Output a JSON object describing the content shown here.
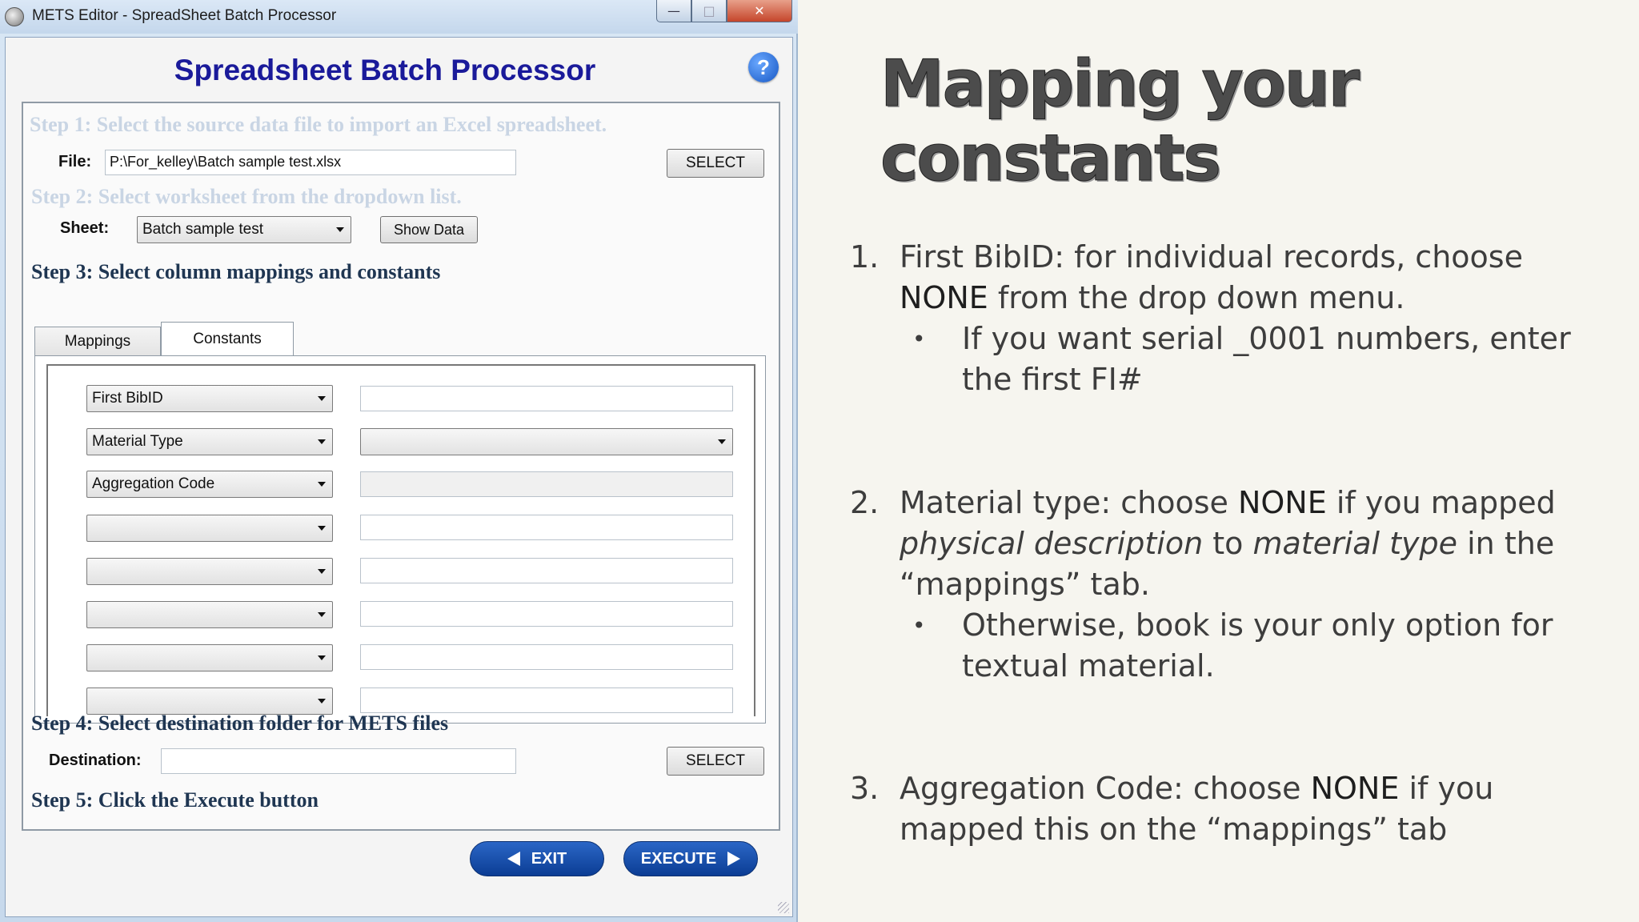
{
  "window": {
    "title": "METS Editor - SpreadSheet Batch Processor",
    "controls": {
      "minimize": "—",
      "maximize": "□",
      "close": "✕"
    }
  },
  "app": {
    "heading": "Spreadsheet Batch Processor",
    "help": "?",
    "step1": "Step 1: Select the source data file to import an Excel spreadsheet.",
    "file_label": "File:",
    "file_value": "P:\\For_kelley\\Batch sample test.xlsx",
    "select_label": "SELECT",
    "step2": "Step 2: Select worksheet from the dropdown list.",
    "sheet_label": "Sheet:",
    "sheet_value": "Batch sample test",
    "show_data_label": "Show Data",
    "step3": "Step 3: Select column mappings and constants",
    "tabs": [
      "Mappings",
      "Constants"
    ],
    "active_tab": "Constants",
    "constants": [
      {
        "field": "First BibID",
        "value": "",
        "value_kind": "text"
      },
      {
        "field": "Material Type",
        "value": "",
        "value_kind": "dropdown"
      },
      {
        "field": "Aggregation Code",
        "value": "",
        "value_kind": "text-disabled"
      },
      {
        "field": "",
        "value": "",
        "value_kind": "text"
      },
      {
        "field": "",
        "value": "",
        "value_kind": "text"
      },
      {
        "field": "",
        "value": "",
        "value_kind": "text"
      },
      {
        "field": "",
        "value": "",
        "value_kind": "text"
      },
      {
        "field": "",
        "value": "",
        "value_kind": "text"
      }
    ],
    "step4": "Step 4: Select destination folder for METS files",
    "destination_label": "Destination:",
    "destination_value": "",
    "destination_select_label": "SELECT",
    "step5": "Step 5: Click the Execute button",
    "exit_label": "EXIT",
    "execute_label": "EXECUTE"
  },
  "slide": {
    "title": "Mapping your constants",
    "items": [
      {
        "number": "1.",
        "parts": [
          "First BibID: for individual records, choose ",
          "NONE",
          " from the drop down menu."
        ],
        "sub": "If you want serial _0001 numbers, enter the first FI#"
      },
      {
        "number": "2.",
        "parts": [
          "Material type: choose ",
          "NONE",
          " if you mapped ",
          "physical description",
          " to ",
          "material type",
          " in the “mappings” tab."
        ],
        "sub": "Otherwise, book is your only option for textual material."
      },
      {
        "number": "3.",
        "parts": [
          "Aggregation Code: choose ",
          "NONE",
          " if you mapped this on the “mappings” tab"
        ]
      }
    ],
    "bullet": "•"
  },
  "colors": {
    "heading": "#1a1a9a",
    "step_text": "#1f3652",
    "step_faded": "#c9d5e4",
    "nav_button": "#0b3d94",
    "slide_background": "#f6f5ef"
  }
}
